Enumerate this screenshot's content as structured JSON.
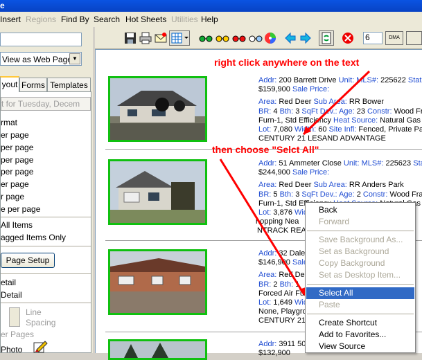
{
  "window": {
    "title_fragment": "e"
  },
  "menubar": {
    "items": [
      {
        "label": "Insert",
        "enabled": true
      },
      {
        "label": "Regions",
        "enabled": false
      },
      {
        "label": "Find By",
        "enabled": true
      },
      {
        "label": "Search",
        "enabled": true
      },
      {
        "label": "Hot Sheets",
        "enabled": true
      },
      {
        "label": "Utilities",
        "enabled": false
      },
      {
        "label": "Help",
        "enabled": true
      }
    ]
  },
  "left_panel": {
    "view_select": "View as Web Page",
    "tabs": [
      "yout",
      "Forms",
      "Templates"
    ],
    "date_field": "t for Tuesday, Decem",
    "format_label": "rmat",
    "format_items": [
      "er page",
      "per page",
      " per page",
      "per page",
      "er page",
      "r page",
      "e per page"
    ],
    "print_all_items": "All Items",
    "print_tagged_items": "agged Items Only",
    "page_setup_button": "Page Setup",
    "detail_items": [
      "etail",
      "Detail"
    ],
    "line_spacing_label": "Line Spacing",
    "er_pages_label": "er Pages",
    "photo_label": "Photo"
  },
  "toolbar": {
    "page_count_value": "6",
    "dma_label": "DMA"
  },
  "annotations": {
    "top": "right click anywhere on the text",
    "middle": "then choose \"Selct All\""
  },
  "listings": [
    {
      "addr_label": "Addr:",
      "addr": "200 Barrett Drive",
      "unit_label": "Unit:",
      "mls_label": "MLS#:",
      "mls": "225622",
      "status_label": "Statu",
      "price": "$159,900",
      "sale_price_label": "Sale Price:",
      "area_label": "Area:",
      "area": "Red Deer",
      "subarea_label": "Sub Area:",
      "subarea": "RR Bower",
      "br_label": "BR:",
      "br": "4",
      "bth_label": "Bth:",
      "bth": "3",
      "sqft_label": "SqFt",
      "dev_label": "Dev.:",
      "age_label": "Age:",
      "age": "23",
      "constr_label": "Constr:",
      "constr": "Wood Fram",
      "line4": "Furn-1, Std Efficiency",
      "heat_label": "Heat Source:",
      "heat": "Natural Gas",
      "lot_label": "Lot:",
      "lot": "7,080",
      "width_label": "Width:",
      "width": "60",
      "site_label": "Site Infl:",
      "site": "Fenced, Private Pa",
      "broker": "CENTURY 21 LESAND ADVANTAGE"
    },
    {
      "addr_label": "Addr:",
      "addr": "51 Ammeter Close",
      "unit_label": "Unit:",
      "mls_label": "MLS#:",
      "mls": "225623",
      "status_label": "Statu",
      "price": "$244,900",
      "sale_price_label": "Sale Price:",
      "area_label": "Area:",
      "area": "Red Deer",
      "subarea_label": "Sub Area:",
      "subarea": "RR Anders Park",
      "br_label": "BR:",
      "br": "5",
      "bth_label": "Bth:",
      "bth": "3",
      "sqft_label": "SqFt",
      "dev_label": "Dev.:",
      "age_label": "Age:",
      "age": "2",
      "constr_label": "Constr:",
      "constr": "Wood Fram",
      "line4": "Furn-1, Std Efficiency",
      "heat_label": "Heat Source:",
      "heat": "Natural Gas",
      "lot_label": "Lot:",
      "lot": "3,876",
      "width_label": "Wid",
      "line6": "hopping Nea",
      "broker": "NTRACK REA"
    },
    {
      "addr_label": "Addr:",
      "addr": "32 Dale",
      "price": "$146,900",
      "sale_price_label": "Sale",
      "area_label": "Area:",
      "area": "Red Dee",
      "br_label": "BR:",
      "br": "2",
      "bth_label": "Bth:",
      "bth": "1",
      "line4": "Forced Air Fur",
      "lot_label": "Lot:",
      "lot": "1,649",
      "width_label": "Wid",
      "line6": "None, Playgrou",
      "broker": "CENTURY 21 LE"
    },
    {
      "addr_label": "Addr:",
      "addr": "3911 50",
      "price": "$132,900"
    }
  ],
  "context_menu": {
    "items": [
      "Back",
      "Forward",
      "Save Background As...",
      "Set as Background",
      "Copy Background",
      "Set as Desktop Item...",
      "Select All",
      "Paste",
      "Create Shortcut",
      "Add to Favorites...",
      "View Source"
    ],
    "selected": "Select All"
  }
}
